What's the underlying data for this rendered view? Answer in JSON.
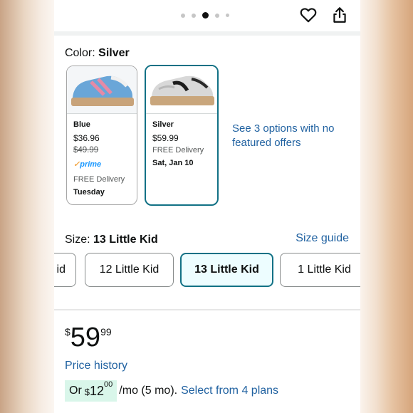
{
  "gallery": {
    "dot_count": 5,
    "active_dot": 2
  },
  "icons": {
    "heart": "heart-icon",
    "share": "share-icon"
  },
  "color": {
    "label": "Color:",
    "selected": "Silver"
  },
  "swatches": [
    {
      "name": "Blue",
      "price": "$36.96",
      "old_price": "$49.99",
      "badge": "prime",
      "delivery": "FREE Delivery",
      "date": "Tuesday",
      "color_main": "#6aa6d8",
      "color_sole": "#c8a37a"
    },
    {
      "name": "Silver",
      "price": "$59.99",
      "delivery": "FREE Delivery",
      "date": "Sat, Jan 10",
      "color_main": "#d8d8d8",
      "color_sole": "#c9a67c"
    }
  ],
  "other_options": "See 3 options with no featured offers",
  "size": {
    "label": "Size:",
    "selected": "13 Little Kid",
    "guide": "Size guide"
  },
  "size_options": [
    "id",
    "12 Little Kid",
    "13 Little Kid",
    "1 Little Kid"
  ],
  "price": {
    "symbol": "$",
    "whole": "59",
    "fraction": "99"
  },
  "price_history": "Price history",
  "plan": {
    "prefix": "Or",
    "symbol": "$",
    "amount": "12",
    "cents": "00",
    "per": "/mo (5 mo).",
    "link": "Select from 4 plans"
  },
  "colors": {
    "accent": "#127185",
    "link": "#2162a1",
    "plan_bg": "#d9f6ea",
    "selected_bg": "#edfdff"
  }
}
